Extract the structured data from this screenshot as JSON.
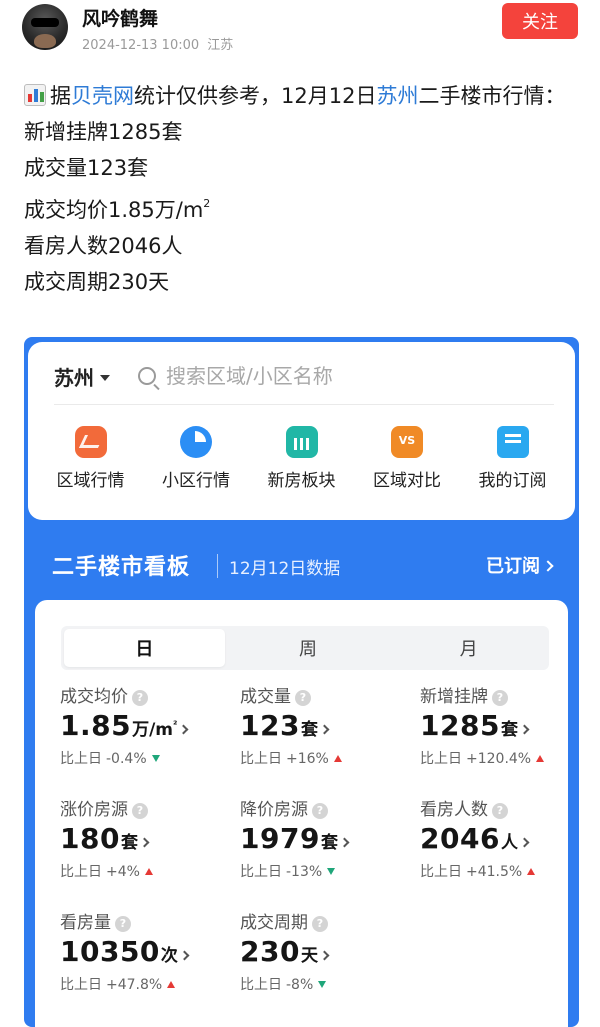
{
  "post": {
    "author_name": "风吟鹤舞",
    "date": "2024-12-13 10:00",
    "location": "江苏",
    "follow_label": "关注",
    "text": {
      "prefix": "据",
      "source": "贝壳网",
      "mid": "统计仅供参考，12月12日",
      "city": "苏州",
      "suffix": "二手楼市行情：",
      "lines": [
        "新增挂牌1285套",
        "成交量123套",
        "看房人数2046人",
        "成交周期230天"
      ],
      "price_line": "成交均价1.85万/m",
      "price_sup": "2"
    }
  },
  "embed": {
    "city": "苏州",
    "search_placeholder": "搜索区域/小区名称",
    "quick_nav": [
      {
        "label": "区域行情",
        "icon": "area-trend-icon"
      },
      {
        "label": "小区行情",
        "icon": "community-icon"
      },
      {
        "label": "新房板块",
        "icon": "new-house-icon"
      },
      {
        "label": "区域对比",
        "icon": "compare-icon"
      },
      {
        "label": "我的订阅",
        "icon": "subscribe-icon"
      }
    ],
    "board": {
      "title": "二手楼市看板",
      "date": "12月12日数据",
      "subscribed_label": "已订阅"
    },
    "tabs": [
      "日",
      "周",
      "月"
    ],
    "active_tab": "日",
    "change_prefix": "比上日",
    "metrics": [
      {
        "label": "成交均价",
        "value": "1.85",
        "unit": "万/m",
        "unit_sup": "²",
        "change": "-0.4%",
        "direction": "down"
      },
      {
        "label": "成交量",
        "value": "123",
        "unit": "套",
        "unit_sup": "",
        "change": "+16%",
        "direction": "up"
      },
      {
        "label": "新增挂牌",
        "value": "1285",
        "unit": "套",
        "unit_sup": "",
        "change": "+120.4%",
        "direction": "up"
      },
      {
        "label": "涨价房源",
        "value": "180",
        "unit": "套",
        "unit_sup": "",
        "change": "+4%",
        "direction": "up"
      },
      {
        "label": "降价房源",
        "value": "1979",
        "unit": "套",
        "unit_sup": "",
        "change": "-13%",
        "direction": "down"
      },
      {
        "label": "看房人数",
        "value": "2046",
        "unit": "人",
        "unit_sup": "",
        "change": "+41.5%",
        "direction": "up"
      },
      {
        "label": "看房量",
        "value": "10350",
        "unit": "次",
        "unit_sup": "",
        "change": "+47.8%",
        "direction": "up"
      },
      {
        "label": "成交周期",
        "value": "230",
        "unit": "天",
        "unit_sup": "",
        "change": "-8%",
        "direction": "down"
      }
    ]
  },
  "colors": {
    "follow_red": "#f4433c",
    "link_blue": "#2e7bd6",
    "board_blue": "#2f7cf0",
    "up_red": "#e53935",
    "down_green": "#1fa67a"
  }
}
